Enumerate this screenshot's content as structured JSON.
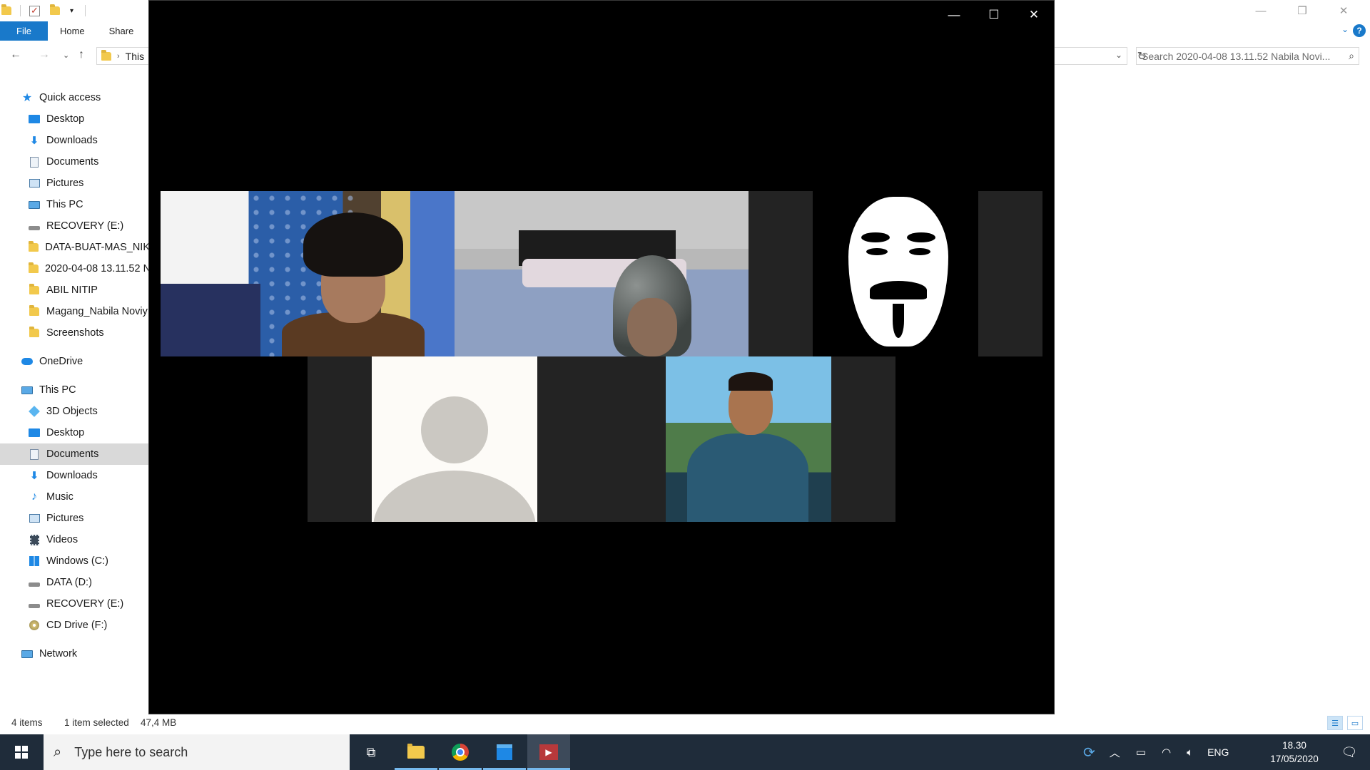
{
  "explorer": {
    "ribbon_tabs": {
      "file": "File",
      "home": "Home",
      "share": "Share"
    },
    "address": {
      "breadcrumb": "This"
    },
    "search": {
      "placeholder": "Search 2020-04-08 13.11.52 Nabila Novi..."
    },
    "sidebar": {
      "quick_access": "Quick access",
      "quick_items": [
        "Desktop",
        "Downloads",
        "Documents",
        "Pictures",
        "This PC",
        "RECOVERY (E:)",
        "DATA-BUAT-MAS_NIK",
        "2020-04-08 13.11.52 N",
        "ABIL NITIP",
        "Magang_Nabila Noviy",
        "Screenshots"
      ],
      "onedrive": "OneDrive",
      "this_pc": "This PC",
      "pc_items": [
        "3D Objects",
        "Desktop",
        "Documents",
        "Downloads",
        "Music",
        "Pictures",
        "Videos",
        "Windows (C:)",
        "DATA (D:)",
        "RECOVERY (E:)",
        "CD Drive (F:)"
      ],
      "network": "Network"
    },
    "status": {
      "items": "4 items",
      "selected": "1 item selected",
      "size": "47,4 MB"
    }
  },
  "taskbar": {
    "search_placeholder": "Type here to search",
    "language": "ENG",
    "time": "18.30",
    "date": "17/05/2020"
  },
  "icons": {
    "minimize": "minimize-icon",
    "maximize": "maximize-icon",
    "close": "close-icon",
    "search": "search-icon",
    "start": "windows-logo-icon"
  }
}
